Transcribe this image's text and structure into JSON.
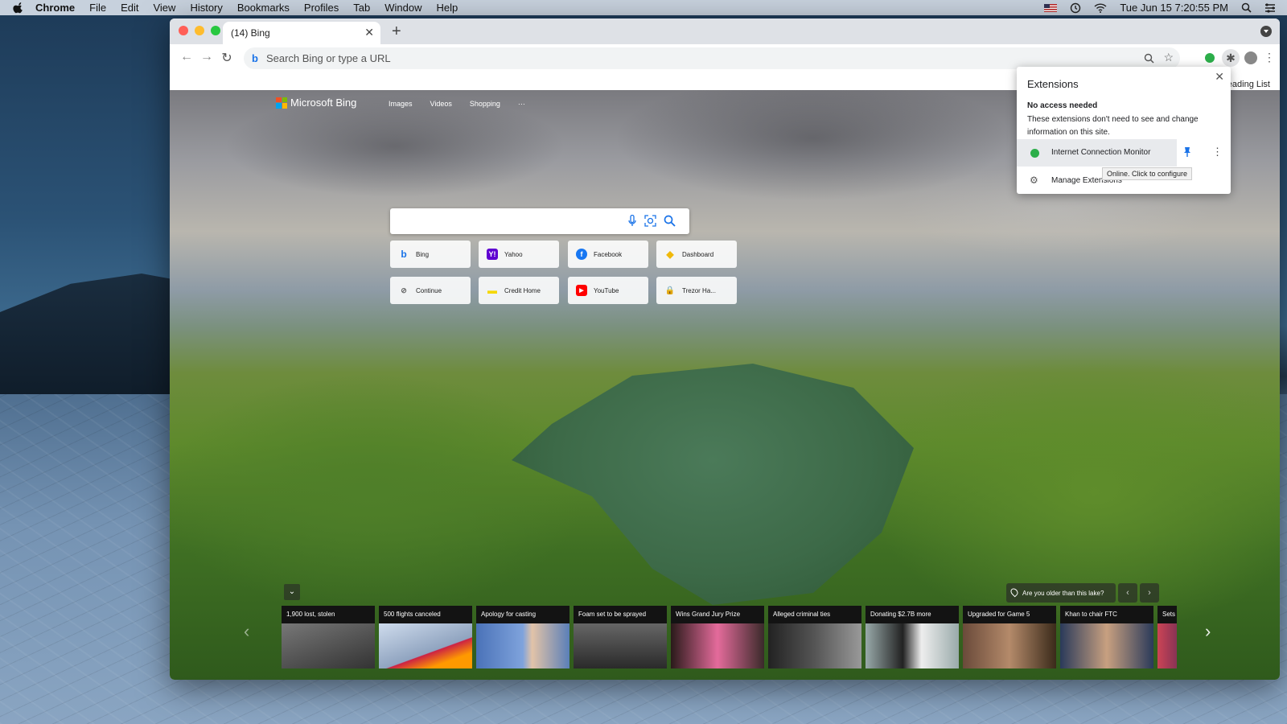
{
  "menubar": {
    "app_name": "Chrome",
    "items": [
      "File",
      "Edit",
      "View",
      "History",
      "Bookmarks",
      "Profiles",
      "Tab",
      "Window",
      "Help"
    ],
    "datetime": "Tue Jun 15  7:20:55 PM"
  },
  "browser": {
    "tab_title": "(14) Bing",
    "tab_close": "✕",
    "new_tab": "+",
    "omnibox_placeholder": "Search Bing or type a URL",
    "reading_list": "eading List"
  },
  "bing": {
    "logo_text": "Microsoft Bing",
    "nav": [
      "Images",
      "Videos",
      "Shopping",
      "···"
    ]
  },
  "tiles": [
    {
      "label": "Bing",
      "icon": "b",
      "color": "#1a73e8"
    },
    {
      "label": "Yahoo",
      "icon": "Y!",
      "color": "#5f01d1"
    },
    {
      "label": "Facebook",
      "icon": "f",
      "color": "#1877f2"
    },
    {
      "label": "Dashboard",
      "icon": "◆",
      "color": "#f0b90b"
    },
    {
      "label": "Continue",
      "icon": "⊘",
      "color": "#666666"
    },
    {
      "label": "Credit Home",
      "icon": "▬",
      "color": "#f5d800"
    },
    {
      "label": "YouTube",
      "icon": "▶",
      "color": "#ff0000"
    },
    {
      "label": "Trezor Ha...",
      "icon": "🔒",
      "color": "#333333"
    }
  ],
  "news": {
    "quiz": "Are you older than this lake?",
    "cards": [
      {
        "title": "1,900 lost, stolen",
        "color": "#5b5b5b"
      },
      {
        "title": "500 flights canceled",
        "color": "#9fb6cf"
      },
      {
        "title": "Apology for casting",
        "color": "#5a7fb8"
      },
      {
        "title": "Foam set to be sprayed",
        "color": "#4a4a4a"
      },
      {
        "title": "Wins Grand Jury Prize",
        "color": "#6b3a3a"
      },
      {
        "title": "Alleged criminal ties",
        "color": "#3d3d3d"
      },
      {
        "title": "Donating $2.7B more",
        "color": "#8a8a8a"
      },
      {
        "title": "Upgraded for Game 5",
        "color": "#5a4a3a"
      },
      {
        "title": "Khan to chair FTC",
        "color": "#3a4a6a"
      },
      {
        "title": "Sets",
        "color": "#8a4a5a"
      }
    ]
  },
  "extensions_popup": {
    "title": "Extensions",
    "close": "✕",
    "subhead": "No access needed",
    "description": "These extensions don't need to see and change information on this site.",
    "extension_name": "Internet Connection Monitor",
    "manage_label": "Manage Extensions",
    "tooltip": "Online. Click to configure"
  }
}
